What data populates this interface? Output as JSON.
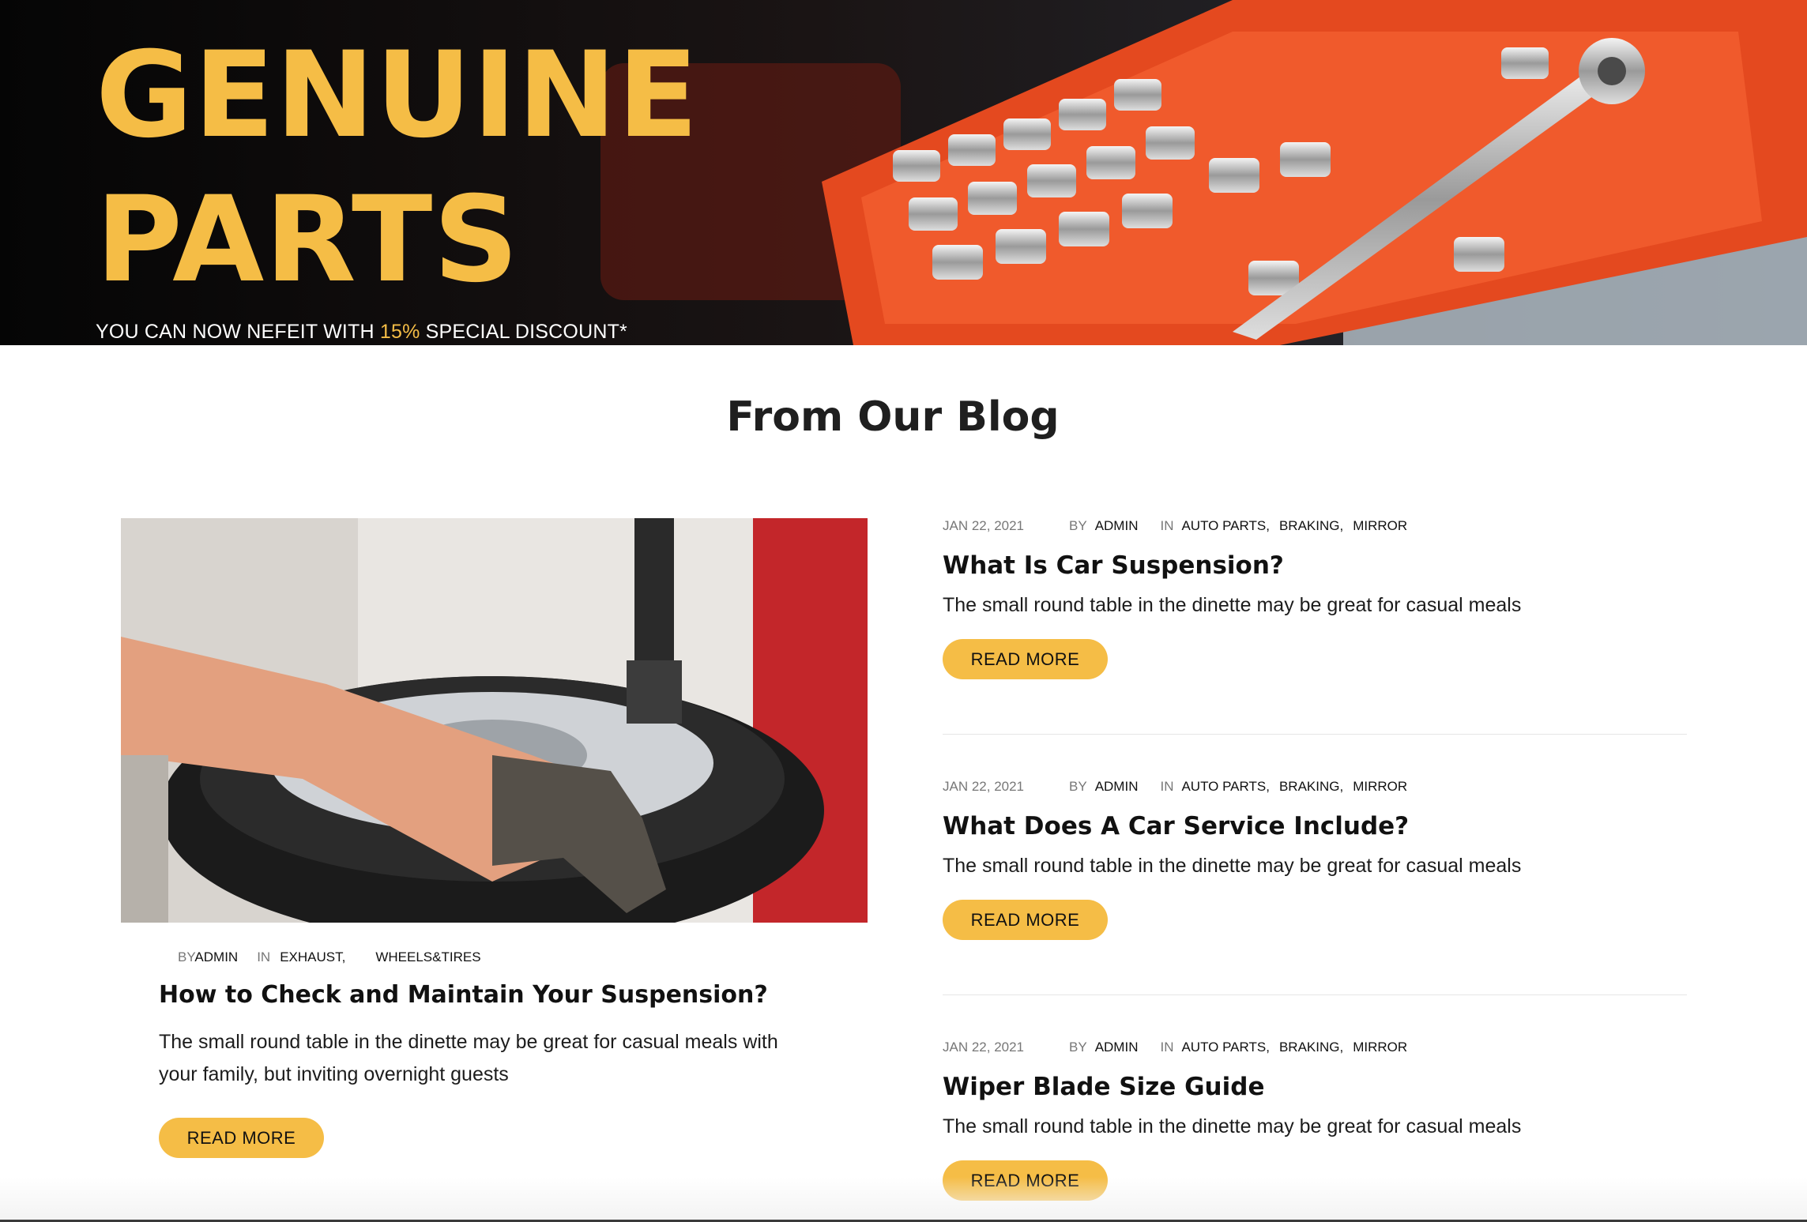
{
  "hero": {
    "title_line1": "GENUINE",
    "title_line2": "PARTS",
    "subtitle_before": "YOU CAN NOW NEFEIT WITH ",
    "subtitle_accent": "15%",
    "subtitle_after": " SPECIAL DISCOUNT*"
  },
  "blog": {
    "heading": "From Our Blog",
    "featured": {
      "by_label": "BY",
      "author": "ADMIN",
      "in_label": "IN",
      "categories": [
        "EXHAUST,",
        "WHEELS&TIRES"
      ],
      "title": "How to Check and Maintain Your Suspension?",
      "excerpt": "The small round table in the dinette may be great for casual meals with your family, but inviting overnight guests",
      "button": "READ MORE"
    },
    "posts": [
      {
        "date": "JAN 22, 2021",
        "by_label": "BY",
        "author": "ADMIN",
        "in_label": "IN",
        "categories": [
          "AUTO PARTS,",
          "BRAKING,",
          "MIRROR"
        ],
        "title": "What Is Car Suspension?",
        "excerpt": "The small round table in the dinette may be great for casual meals",
        "button": "READ MORE"
      },
      {
        "date": "JAN 22, 2021",
        "by_label": "BY",
        "author": "ADMIN",
        "in_label": "IN",
        "categories": [
          "AUTO PARTS,",
          "BRAKING,",
          "MIRROR"
        ],
        "title": "What Does A Car Service Include?",
        "excerpt": "The small round table in the dinette may be great for casual meals",
        "button": "READ MORE"
      },
      {
        "date": "JAN 22, 2021",
        "by_label": "BY",
        "author": "ADMIN",
        "in_label": "IN",
        "categories": [
          "AUTO PARTS,",
          "BRAKING,",
          "MIRROR"
        ],
        "title": "Wiper Blade Size Guide",
        "excerpt": "The small round table in the dinette may be great for casual meals",
        "button": "READ MORE"
      }
    ]
  },
  "colors": {
    "accent": "#f5bd46",
    "hero_bg": "#0a0a0a",
    "toolbox": "#e4491f"
  }
}
